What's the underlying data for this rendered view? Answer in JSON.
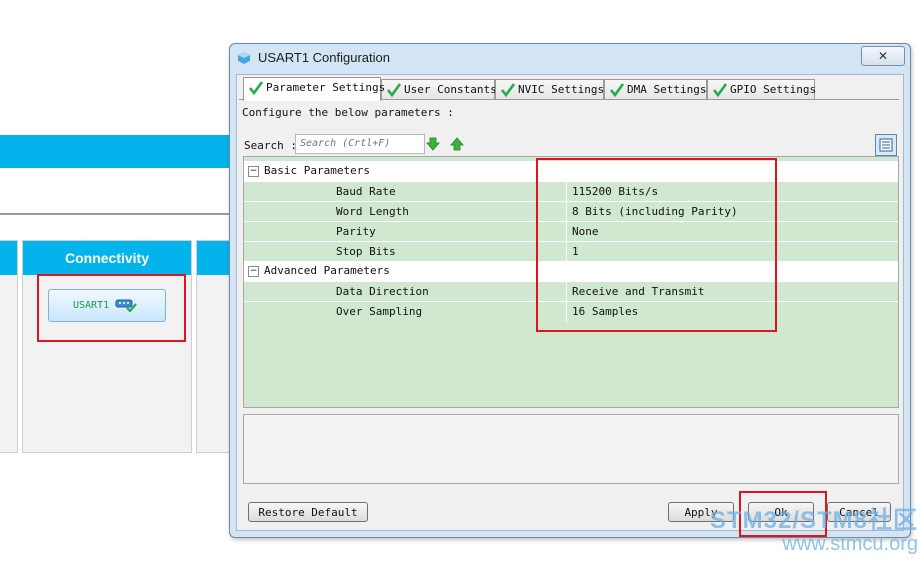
{
  "background": {
    "category_header": "Connectivity",
    "peripheral_button_label": "USART1"
  },
  "dialog": {
    "title": "USART1 Configuration",
    "close_glyph": "✕",
    "tabs": [
      {
        "label": "Parameter Settings",
        "active": true
      },
      {
        "label": "User Constants",
        "active": false
      },
      {
        "label": "NVIC Settings",
        "active": false
      },
      {
        "label": "DMA Settings",
        "active": false
      },
      {
        "label": "GPIO Settings",
        "active": false
      }
    ],
    "instruction": "Configure the below parameters :",
    "search": {
      "label": "Search :",
      "placeholder": "Search (Crtl+F)"
    },
    "groups": [
      {
        "name": "Basic Parameters",
        "params": [
          {
            "name": "Baud Rate",
            "value": "115200 Bits/s"
          },
          {
            "name": "Word Length",
            "value": "8 Bits (including Parity)"
          },
          {
            "name": "Parity",
            "value": "None"
          },
          {
            "name": "Stop Bits",
            "value": "1"
          }
        ]
      },
      {
        "name": "Advanced Parameters",
        "params": [
          {
            "name": "Data Direction",
            "value": "Receive and Transmit"
          },
          {
            "name": "Over Sampling",
            "value": "16 Samples"
          }
        ]
      }
    ],
    "buttons": {
      "restore_default": "Restore Default",
      "apply": "Apply",
      "ok": "Ok",
      "cancel": "Cancel"
    }
  },
  "watermark": {
    "line1": "STM32/STM8社区",
    "line2": "www.stmcu.org"
  },
  "colors": {
    "accent": "#03b3ec",
    "grid_bg": "#d0e8d0",
    "highlight": "#e0141d",
    "dialog_frame": "#d3e5f5"
  }
}
